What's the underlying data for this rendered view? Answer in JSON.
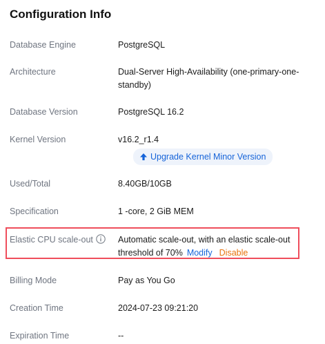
{
  "panel": {
    "title": "Configuration Info"
  },
  "rows": {
    "engine": {
      "label": "Database Engine",
      "value": "PostgreSQL"
    },
    "architecture": {
      "label": "Architecture",
      "value_line1": "Dual-Server High-Availability (one-primary-one-",
      "value_line2": "standby)"
    },
    "version": {
      "label": "Database Version",
      "value": "PostgreSQL 16.2"
    },
    "kernel": {
      "label": "Kernel Version",
      "value": "v16.2_r1.4",
      "upgrade_label": "Upgrade Kernel Minor Version"
    },
    "used_total": {
      "label": "Used/Total",
      "value": "8.40GB/10GB"
    },
    "spec": {
      "label": "Specification",
      "value": "1 -core, 2 GiB MEM"
    },
    "elastic": {
      "label": "Elastic CPU scale-out",
      "value_line1": "Automatic scale-out, with an elastic scale-out",
      "value_line2": "threshold of 70%",
      "modify_label": "Modify",
      "disable_label": "Disable"
    },
    "billing": {
      "label": "Billing Mode",
      "value": "Pay as You Go"
    },
    "creation": {
      "label": "Creation Time",
      "value": "2024-07-23 09:21:20"
    },
    "expiration": {
      "label": "Expiration Time",
      "value": "--"
    }
  },
  "icons": {
    "upgrade": "arrow-up-icon",
    "info": "info-circle-icon"
  },
  "colors": {
    "link": "#1664d9",
    "warning_link": "#e8710a",
    "highlight_border": "#ef4d5b",
    "label": "#6f7580"
  }
}
